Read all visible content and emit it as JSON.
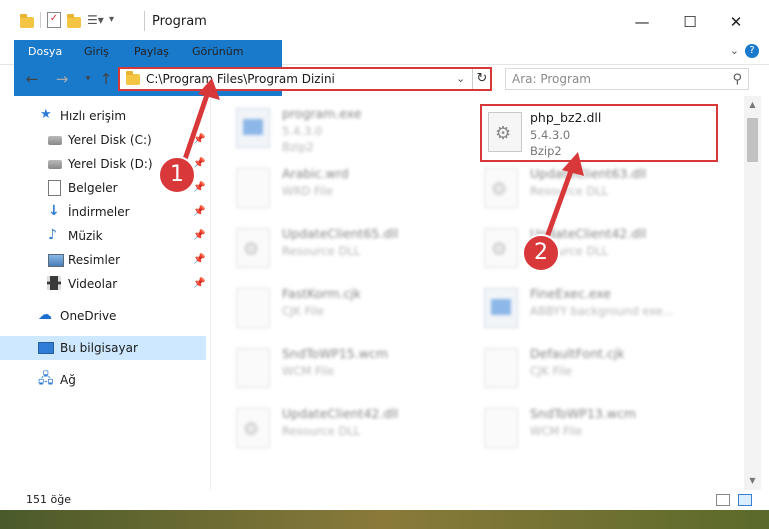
{
  "window": {
    "title": "Program",
    "controls": {
      "minimize": "—",
      "maximize": "☐",
      "close": "✕"
    }
  },
  "ribbon": {
    "tabs": [
      "Dosya",
      "Giriş",
      "Paylaş",
      "Görünüm"
    ],
    "help": "?"
  },
  "nav": {
    "address": "C:\\Program Files\\Program Dizini",
    "search_placeholder": "Ara: Program"
  },
  "sidebar": {
    "items": [
      {
        "label": "Hızlı erişim",
        "icon": "star-icon"
      },
      {
        "label": "Yerel Disk (C:)",
        "icon": "drive-icon"
      },
      {
        "label": "Yerel Disk (D:)",
        "icon": "drive-icon"
      },
      {
        "label": "Belgeler",
        "icon": "documents-icon"
      },
      {
        "label": "İndirmeler",
        "icon": "download-icon"
      },
      {
        "label": "Müzik",
        "icon": "music-icon"
      },
      {
        "label": "Resimler",
        "icon": "pictures-icon"
      },
      {
        "label": "Videolar",
        "icon": "video-icon"
      },
      {
        "label": "OneDrive",
        "icon": "cloud-icon"
      },
      {
        "label": "Bu bilgisayar",
        "icon": "computer-icon"
      },
      {
        "label": "Ağ",
        "icon": "network-icon"
      }
    ]
  },
  "files": [
    {
      "name": "program.exe",
      "line1": "5.4.3.0",
      "line2": "Bzip2"
    },
    {
      "name": "php_bz2.dll",
      "line1": "5.4.3.0",
      "line2": "Bzip2"
    },
    {
      "name": "Arabic.wrd",
      "line1": "WRD File",
      "line2": ""
    },
    {
      "name": "UpdateClient63.dll",
      "line1": "Resource DLL",
      "line2": ""
    },
    {
      "name": "UpdateClient65.dll",
      "line1": "Resource DLL",
      "line2": ""
    },
    {
      "name": "UpdateClient42.dll",
      "line1": "Resource DLL",
      "line2": ""
    },
    {
      "name": "FastKorm.cjk",
      "line1": "CJK File",
      "line2": ""
    },
    {
      "name": "FineExec.exe",
      "line1": "ABBYY background exe...",
      "line2": ""
    },
    {
      "name": "SndToWP15.wcm",
      "line1": "WCM File",
      "line2": ""
    },
    {
      "name": "DefaultFont.cjk",
      "line1": "CJK File",
      "line2": ""
    },
    {
      "name": "UpdateClient42.dll",
      "line1": "Resource DLL",
      "line2": ""
    },
    {
      "name": "SndToWP13.wcm",
      "line1": "WCM File",
      "line2": ""
    }
  ],
  "status": {
    "count": "151 öğe"
  },
  "callouts": {
    "one": "1",
    "two": "2"
  },
  "colors": {
    "accent": "#1979ca",
    "highlight": "#d8383a",
    "selected": "#cde8ff"
  }
}
